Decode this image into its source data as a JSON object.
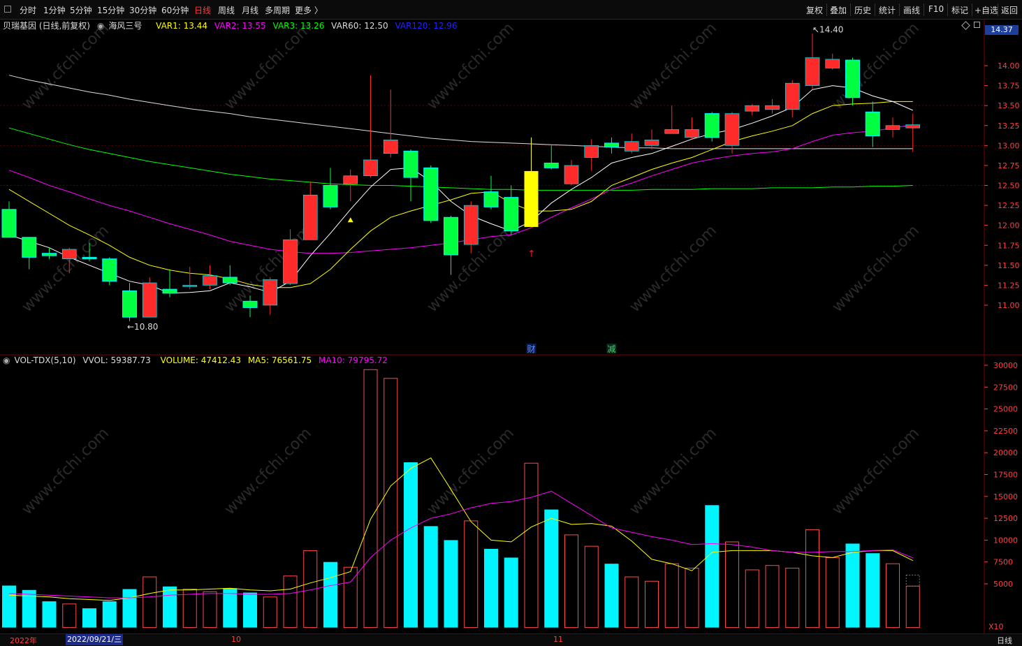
{
  "toolbar": {
    "periods": [
      "分时",
      "1分钟",
      "5分钟",
      "15分钟",
      "30分钟",
      "60分钟",
      "日线",
      "周线",
      "月线",
      "多周期",
      "更多 〉"
    ],
    "active_period": "日线",
    "right_buttons": [
      "复权",
      "叠加",
      "历史",
      "统计",
      "画线",
      "F10",
      "标记",
      "+自选",
      "返回"
    ]
  },
  "legend": {
    "stock": "贝瑞基因 (日线,前复权)",
    "indicator_name": "海风三号",
    "var1": "VAR1: 13.44",
    "var2": "VAR2: 13.55",
    "var3": "VAR3: 13.26",
    "var60": "VAR60: 12.50",
    "var120": "VAR120: 12.96"
  },
  "vol_legend": {
    "name": "VOL-TDX(5,10)",
    "vvol": "VVOL: 59387.73",
    "volume": "VOLUME: 47412.43",
    "ma5": "MA5: 76561.75",
    "ma10": "MA10: 79795.72"
  },
  "axis": {
    "current_price": "14.37",
    "price_ticks": [
      "14.00",
      "13.75",
      "13.50",
      "13.25",
      "13.00",
      "12.75",
      "12.50",
      "12.25",
      "12.00",
      "11.75",
      "11.50",
      "11.25",
      "11.00"
    ],
    "volume_ticks": [
      "30000",
      "27500",
      "25000",
      "22500",
      "20000",
      "17500",
      "15000",
      "12500",
      "10000",
      "7500",
      "5000"
    ],
    "volume_unit": "X10"
  },
  "annotations": {
    "high_label": "14.40",
    "low_label": "←10.80",
    "event_cai": "财",
    "event_jian": "减"
  },
  "bottom": {
    "year_label": "2022年",
    "date_chip": "2022/09/21/三",
    "month_10": "10",
    "month_11": "11",
    "period_label": "日线"
  },
  "colors": {
    "up": "#ff2a2a",
    "down": "#00f5ff",
    "var1": "#ffffff",
    "var2": "#ffff00",
    "var3": "#ff00ff",
    "var60": "#00ff00",
    "var120": "#ffffff",
    "grid": "#7a0000",
    "axis_text": "#ff4040"
  },
  "chart_data": {
    "type": "candlestick",
    "price_range": [
      10.75,
      14.4
    ],
    "volume_range": [
      0,
      30000
    ],
    "candles": [
      {
        "o": 12.2,
        "c": 11.85,
        "h": 12.3,
        "l": 11.85,
        "v": 4800,
        "g": 1
      },
      {
        "o": 11.85,
        "c": 11.6,
        "h": 11.85,
        "l": 11.45,
        "v": 4300,
        "g": 1
      },
      {
        "o": 11.65,
        "c": 11.62,
        "h": 11.72,
        "l": 11.58,
        "v": 3000,
        "g": 1
      },
      {
        "o": 11.58,
        "c": 11.7,
        "h": 11.72,
        "l": 11.4,
        "v": 2700,
        "g": 0
      },
      {
        "o": 11.6,
        "c": 11.58,
        "h": 11.78,
        "l": 11.55,
        "v": 2200,
        "g": 1
      },
      {
        "o": 11.58,
        "c": 11.3,
        "h": 11.6,
        "l": 11.25,
        "v": 3000,
        "g": 1
      },
      {
        "o": 11.18,
        "c": 10.85,
        "h": 11.28,
        "l": 10.8,
        "v": 4400,
        "g": 1
      },
      {
        "o": 10.85,
        "c": 11.28,
        "h": 11.35,
        "l": 10.85,
        "v": 5800,
        "g": 0
      },
      {
        "o": 11.2,
        "c": 11.15,
        "h": 11.45,
        "l": 11.1,
        "v": 4700,
        "g": 1
      },
      {
        "o": 11.25,
        "c": 11.25,
        "h": 11.48,
        "l": 11.2,
        "v": 4400,
        "g": 0
      },
      {
        "o": 11.25,
        "c": 11.37,
        "h": 11.5,
        "l": 11.2,
        "v": 4100,
        "g": 0
      },
      {
        "o": 11.35,
        "c": 11.28,
        "h": 11.5,
        "l": 11.25,
        "v": 4500,
        "g": 1
      },
      {
        "o": 11.05,
        "c": 10.97,
        "h": 11.12,
        "l": 10.85,
        "v": 4000,
        "g": 1
      },
      {
        "o": 11.0,
        "c": 11.32,
        "h": 11.35,
        "l": 10.88,
        "v": 3500,
        "g": 0
      },
      {
        "o": 11.27,
        "c": 11.82,
        "h": 11.95,
        "l": 11.25,
        "v": 5900,
        "g": 0
      },
      {
        "o": 11.82,
        "c": 12.38,
        "h": 12.55,
        "l": 11.82,
        "v": 8800,
        "g": 0
      },
      {
        "o": 12.5,
        "c": 12.23,
        "h": 12.72,
        "l": 12.2,
        "v": 7500,
        "g": 1
      },
      {
        "o": 12.52,
        "c": 12.62,
        "h": 12.7,
        "l": 12.3,
        "v": 6900,
        "g": 0
      },
      {
        "o": 12.62,
        "c": 12.82,
        "h": 13.88,
        "l": 12.6,
        "v": 29500,
        "g": 0
      },
      {
        "o": 12.9,
        "c": 13.07,
        "h": 13.7,
        "l": 12.85,
        "v": 28500,
        "g": 0
      },
      {
        "o": 12.93,
        "c": 12.6,
        "h": 12.95,
        "l": 12.3,
        "v": 18900,
        "g": 1
      },
      {
        "o": 12.72,
        "c": 12.06,
        "h": 12.75,
        "l": 12.03,
        "v": 11600,
        "g": 1
      },
      {
        "o": 12.1,
        "c": 11.63,
        "h": 12.12,
        "l": 11.38,
        "v": 10000,
        "g": 1
      },
      {
        "o": 12.25,
        "c": 11.76,
        "h": 12.3,
        "l": 11.65,
        "v": 12200,
        "g": 0
      },
      {
        "o": 12.42,
        "c": 12.23,
        "h": 12.62,
        "l": 12.2,
        "v": 9000,
        "g": 1
      },
      {
        "o": 12.35,
        "c": 11.93,
        "h": 12.5,
        "l": 11.88,
        "v": 8000,
        "g": 1
      },
      {
        "o": 11.98,
        "c": 12.68,
        "h": 13.1,
        "l": 11.98,
        "v": 18800,
        "g": 0
      },
      {
        "o": 12.78,
        "c": 12.72,
        "h": 13.0,
        "l": 12.7,
        "v": 13500,
        "g": 1
      },
      {
        "o": 12.52,
        "c": 12.75,
        "h": 12.82,
        "l": 12.5,
        "v": 10600,
        "g": 0
      },
      {
        "o": 12.85,
        "c": 13.0,
        "h": 13.08,
        "l": 12.68,
        "v": 9300,
        "g": 0
      },
      {
        "o": 13.03,
        "c": 12.98,
        "h": 13.1,
        "l": 12.9,
        "v": 7300,
        "g": 1
      },
      {
        "o": 12.93,
        "c": 13.05,
        "h": 13.15,
        "l": 12.9,
        "v": 5800,
        "g": 0
      },
      {
        "o": 13.0,
        "c": 13.07,
        "h": 13.2,
        "l": 12.95,
        "v": 5300,
        "g": 0
      },
      {
        "o": 13.15,
        "c": 13.2,
        "h": 13.5,
        "l": 13.15,
        "v": 7300,
        "g": 0
      },
      {
        "o": 13.1,
        "c": 13.2,
        "h": 13.35,
        "l": 13.08,
        "v": 6800,
        "g": 0
      },
      {
        "o": 13.4,
        "c": 13.1,
        "h": 13.42,
        "l": 13.05,
        "v": 14000,
        "g": 1
      },
      {
        "o": 13.0,
        "c": 13.4,
        "h": 13.42,
        "l": 12.9,
        "v": 9800,
        "g": 0
      },
      {
        "o": 13.43,
        "c": 13.5,
        "h": 13.52,
        "l": 13.38,
        "v": 6600,
        "g": 0
      },
      {
        "o": 13.45,
        "c": 13.5,
        "h": 13.58,
        "l": 13.4,
        "v": 7100,
        "g": 0
      },
      {
        "o": 13.45,
        "c": 13.78,
        "h": 13.82,
        "l": 13.35,
        "v": 6800,
        "g": 0
      },
      {
        "o": 13.75,
        "c": 14.1,
        "h": 14.4,
        "l": 13.7,
        "v": 11200,
        "g": 0
      },
      {
        "o": 13.97,
        "c": 14.08,
        "h": 14.15,
        "l": 13.95,
        "v": 8000,
        "g": 0
      },
      {
        "o": 14.07,
        "c": 13.6,
        "h": 14.1,
        "l": 13.5,
        "v": 9600,
        "g": 1
      },
      {
        "o": 13.42,
        "c": 13.12,
        "h": 13.55,
        "l": 12.98,
        "v": 8500,
        "g": 1
      },
      {
        "o": 13.2,
        "c": 13.25,
        "h": 13.35,
        "l": 13.1,
        "v": 7300,
        "g": 0
      },
      {
        "o": 13.22,
        "c": 13.26,
        "h": 13.4,
        "l": 12.92,
        "v": 4741,
        "g": 0
      }
    ],
    "lines": {
      "var1": [
        11.88,
        11.8,
        11.72,
        11.6,
        11.5,
        11.4,
        11.3,
        11.25,
        11.15,
        11.16,
        11.18,
        11.28,
        11.23,
        11.16,
        11.3,
        11.62,
        11.9,
        12.2,
        12.48,
        12.7,
        12.72,
        12.55,
        12.3,
        12.12,
        12.02,
        11.93,
        12.05,
        12.28,
        12.45,
        12.6,
        12.78,
        12.85,
        12.9,
        12.99,
        13.08,
        13.15,
        13.2,
        13.28,
        13.37,
        13.48,
        13.7,
        13.75,
        13.72,
        13.62,
        13.55,
        13.44
      ],
      "var2": [
        12.45,
        12.3,
        12.15,
        12.0,
        11.88,
        11.75,
        11.6,
        11.5,
        11.44,
        11.4,
        11.38,
        11.33,
        11.26,
        11.22,
        11.22,
        11.27,
        11.45,
        11.7,
        11.93,
        12.1,
        12.18,
        12.25,
        12.32,
        12.4,
        12.42,
        12.28,
        12.18,
        12.18,
        12.2,
        12.3,
        12.5,
        12.6,
        12.7,
        12.78,
        12.85,
        12.95,
        13.05,
        13.12,
        13.18,
        13.25,
        13.4,
        13.5,
        13.52,
        13.53,
        13.55,
        13.55
      ],
      "var3": [
        12.69,
        12.6,
        12.5,
        12.42,
        12.33,
        12.25,
        12.18,
        12.1,
        12.02,
        11.95,
        11.88,
        11.8,
        11.75,
        11.7,
        11.67,
        11.65,
        11.65,
        11.66,
        11.68,
        11.7,
        11.72,
        11.75,
        11.78,
        11.82,
        11.86,
        11.88,
        11.97,
        12.1,
        12.22,
        12.33,
        12.45,
        12.53,
        12.62,
        12.7,
        12.78,
        12.83,
        12.87,
        12.9,
        12.92,
        12.96,
        13.05,
        13.13,
        13.16,
        13.18,
        13.22,
        13.26
      ],
      "var60": [
        13.22,
        13.15,
        13.08,
        13.01,
        12.95,
        12.9,
        12.85,
        12.8,
        12.76,
        12.72,
        12.68,
        12.64,
        12.61,
        12.58,
        12.56,
        12.54,
        12.52,
        12.51,
        12.5,
        12.5,
        12.49,
        12.48,
        12.47,
        12.46,
        12.45,
        12.45,
        12.44,
        12.44,
        12.44,
        12.44,
        12.44,
        12.44,
        12.45,
        12.45,
        12.45,
        12.46,
        12.46,
        12.46,
        12.47,
        12.47,
        12.47,
        12.48,
        12.48,
        12.49,
        12.49,
        12.5
      ],
      "var120": [
        13.88,
        13.82,
        13.77,
        13.72,
        13.67,
        13.63,
        13.58,
        13.54,
        13.5,
        13.46,
        13.43,
        13.4,
        13.36,
        13.33,
        13.3,
        13.27,
        13.24,
        13.21,
        13.18,
        13.15,
        13.12,
        13.09,
        13.07,
        13.05,
        13.04,
        13.03,
        13.02,
        13.01,
        13.0,
        12.99,
        12.98,
        12.97,
        12.97,
        12.96,
        12.96,
        12.96,
        12.96,
        12.96,
        12.96,
        12.96,
        12.96,
        12.96,
        12.96,
        12.96,
        12.96,
        12.96
      ],
      "ma5_vol": [
        3700,
        3600,
        3500,
        3300,
        3200,
        3100,
        3400,
        3900,
        4300,
        4300,
        4400,
        4500,
        4300,
        4200,
        4400,
        5100,
        5700,
        6400,
        12400,
        16200,
        18200,
        19400,
        15800,
        12100,
        10000,
        9800,
        11500,
        12500,
        11800,
        11900,
        11600,
        9900,
        7800,
        7300,
        6500,
        8600,
        8800,
        8800,
        8800,
        8600,
        8200,
        8000,
        8600,
        8800,
        8800,
        7656
      ],
      "ma10_vol": [
        3900,
        3800,
        3700,
        3600,
        3500,
        3400,
        3400,
        3500,
        3700,
        3800,
        3900,
        3900,
        3800,
        3800,
        3900,
        4300,
        4800,
        5200,
        8000,
        10000,
        11400,
        12500,
        13000,
        13700,
        14200,
        14400,
        14900,
        15600,
        14200,
        12800,
        11400,
        10900,
        10400,
        10000,
        9500,
        9600,
        9500,
        9200,
        8800,
        8600,
        8600,
        8700,
        8700,
        8800,
        8900,
        7980
      ]
    }
  }
}
